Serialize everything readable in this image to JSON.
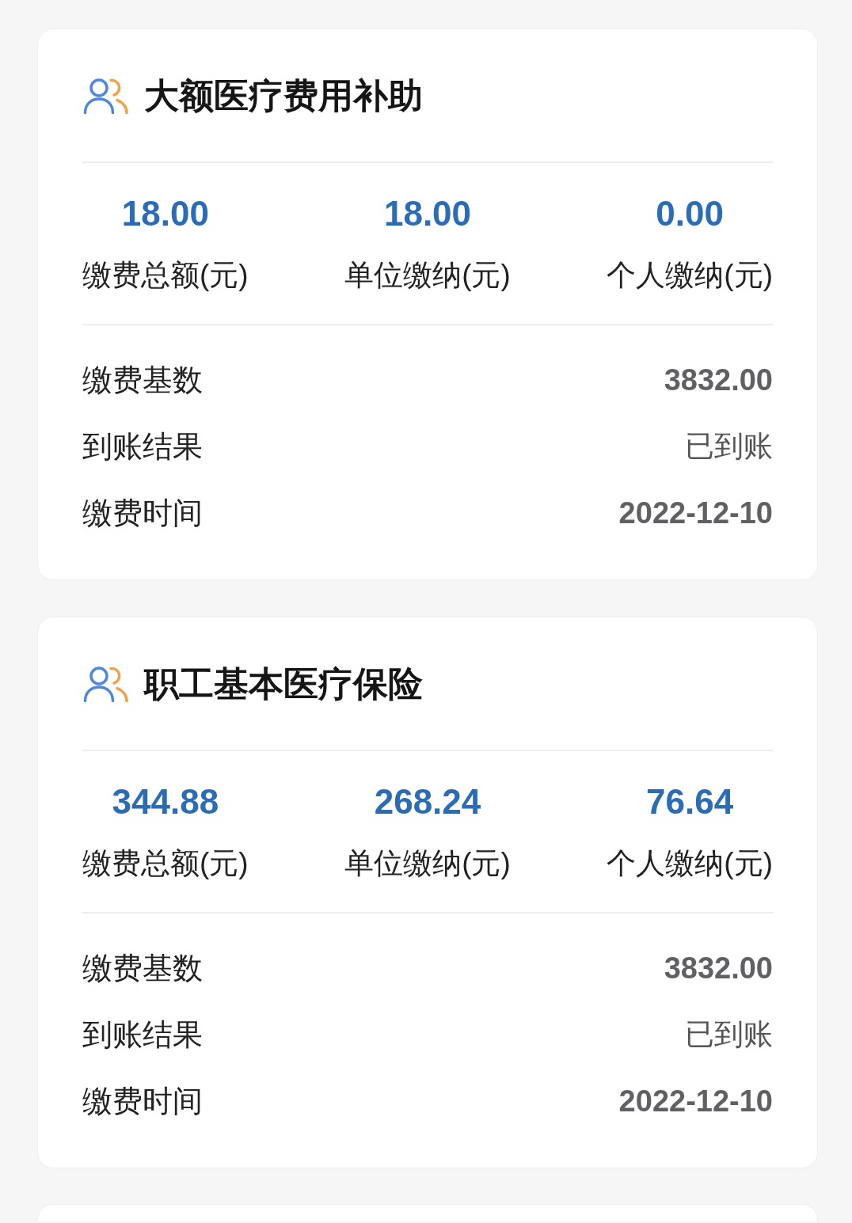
{
  "cards": [
    {
      "title": "大额医疗费用补助",
      "stats": [
        {
          "value": "18.00",
          "label": "缴费总额(元)"
        },
        {
          "value": "18.00",
          "label": "单位缴纳(元)"
        },
        {
          "value": "0.00",
          "label": "个人缴纳(元)"
        }
      ],
      "details": [
        {
          "kind": "amount",
          "label": "缴费基数",
          "value": "3832.00"
        },
        {
          "kind": "status",
          "label": "到账结果",
          "value": "已到账"
        },
        {
          "kind": "date",
          "label": "缴费时间",
          "value": "2022-12-10"
        }
      ]
    },
    {
      "title": "职工基本医疗保险",
      "stats": [
        {
          "value": "344.88",
          "label": "缴费总额(元)"
        },
        {
          "value": "268.24",
          "label": "单位缴纳(元)"
        },
        {
          "value": "76.64",
          "label": "个人缴纳(元)"
        }
      ],
      "details": [
        {
          "kind": "amount",
          "label": "缴费基数",
          "value": "3832.00"
        },
        {
          "kind": "status",
          "label": "到账结果",
          "value": "已到账"
        },
        {
          "kind": "date",
          "label": "缴费时间",
          "value": "2022-12-10"
        }
      ]
    }
  ]
}
